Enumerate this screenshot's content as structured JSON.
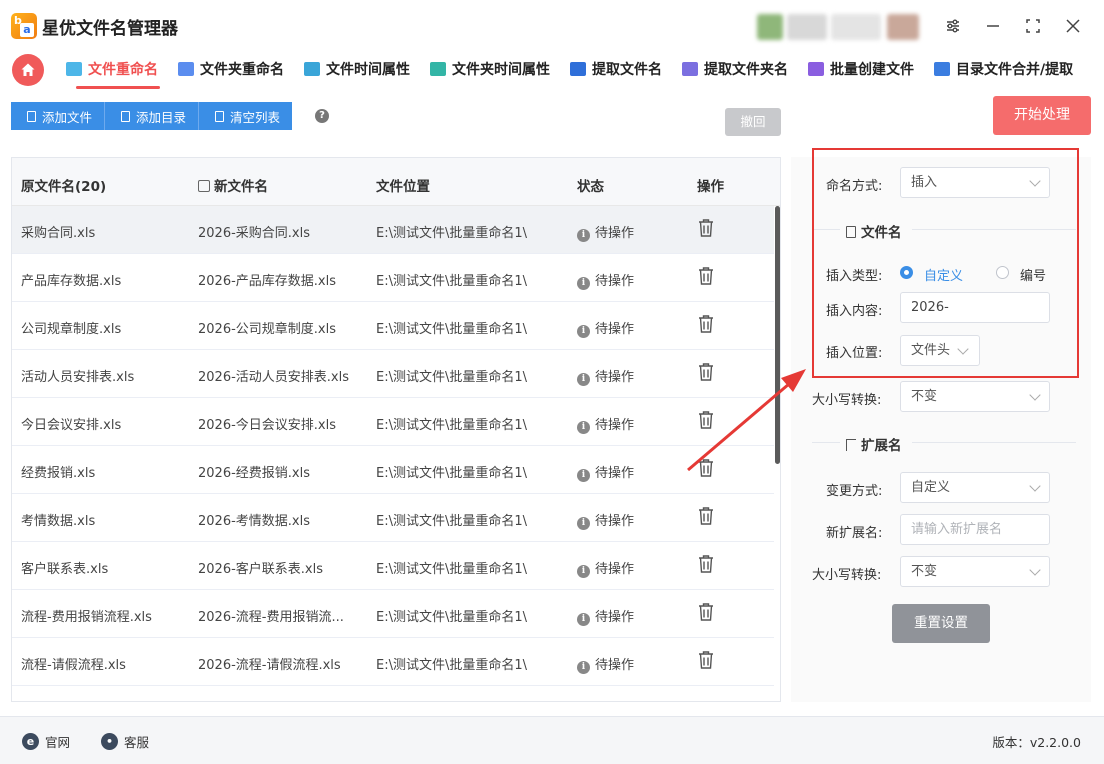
{
  "app": {
    "title": "星优文件名管理器"
  },
  "tabs": [
    {
      "label": "文件重命名",
      "active": true,
      "color": "#4db6e8"
    },
    {
      "label": "文件夹重命名",
      "color": "#5b8def"
    },
    {
      "label": "文件时间属性",
      "color": "#3aa5d8"
    },
    {
      "label": "文件夹时间属性",
      "color": "#33b5a6"
    },
    {
      "label": "提取文件名",
      "color": "#2f6fd9"
    },
    {
      "label": "提取文件夹名",
      "color": "#7b6fe0"
    },
    {
      "label": "批量创建文件",
      "color": "#8a5ee0"
    },
    {
      "label": "目录文件合并/提取",
      "color": "#3b7de0"
    }
  ],
  "toolbar": {
    "add_file": "添加文件",
    "add_dir": "添加目录",
    "clear_list": "清空列表",
    "undo": "撤回",
    "start": "开始处理"
  },
  "table": {
    "headers": {
      "original": "原文件名(20)",
      "new_name": "新文件名",
      "location": "文件位置",
      "status": "状态",
      "action": "操作"
    },
    "rows": [
      {
        "original": "采购合同.xls",
        "new_name": "2026-采购合同.xls",
        "location": "E:\\测试文件\\批量重命名1\\",
        "status": "待操作"
      },
      {
        "original": "产品库存数据.xls",
        "new_name": "2026-产品库存数据.xls",
        "location": "E:\\测试文件\\批量重命名1\\",
        "status": "待操作"
      },
      {
        "original": "公司规章制度.xls",
        "new_name": "2026-公司规章制度.xls",
        "location": "E:\\测试文件\\批量重命名1\\",
        "status": "待操作"
      },
      {
        "original": "活动人员安排表.xls",
        "new_name": "2026-活动人员安排表.xls",
        "location": "E:\\测试文件\\批量重命名1\\",
        "status": "待操作"
      },
      {
        "original": "今日会议安排.xls",
        "new_name": "2026-今日会议安排.xls",
        "location": "E:\\测试文件\\批量重命名1\\",
        "status": "待操作"
      },
      {
        "original": "经费报销.xls",
        "new_name": "2026-经费报销.xls",
        "location": "E:\\测试文件\\批量重命名1\\",
        "status": "待操作"
      },
      {
        "original": "考情数据.xls",
        "new_name": "2026-考情数据.xls",
        "location": "E:\\测试文件\\批量重命名1\\",
        "status": "待操作"
      },
      {
        "original": "客户联系表.xls",
        "new_name": "2026-客户联系表.xls",
        "location": "E:\\测试文件\\批量重命名1\\",
        "status": "待操作"
      },
      {
        "original": "流程-费用报销流程.xls",
        "new_name": "2026-流程-费用报销流...",
        "location": "E:\\测试文件\\批量重命名1\\",
        "status": "待操作"
      },
      {
        "original": "流程-请假流程.xls",
        "new_name": "2026-流程-请假流程.xls",
        "location": "E:\\测试文件\\批量重命名1\\",
        "status": "待操作"
      }
    ]
  },
  "settings": {
    "naming_mode_label": "命名方式:",
    "naming_mode_value": "插入",
    "filename_section": "文件名",
    "insert_type_label": "插入类型:",
    "insert_type_option1": "自定义",
    "insert_type_option2": "编号",
    "insert_content_label": "插入内容:",
    "insert_content_value": "2026-",
    "insert_position_label": "插入位置:",
    "insert_position_value": "文件头",
    "case_label": "大小写转换:",
    "case_value": "不变",
    "ext_section": "扩展名",
    "change_mode_label": "变更方式:",
    "change_mode_value": "自定义",
    "new_ext_label": "新扩展名:",
    "new_ext_placeholder": "请输入新扩展名",
    "ext_case_label": "大小写转换:",
    "ext_case_value": "不变",
    "reset": "重置设置"
  },
  "footer": {
    "website": "官网",
    "support": "客服",
    "version": "版本：v2.2.0.0"
  },
  "colors": {
    "accent": "#f05050",
    "primary": "#3a8ee6",
    "start_button": "#f56c6c",
    "highlight": "#e53935"
  }
}
